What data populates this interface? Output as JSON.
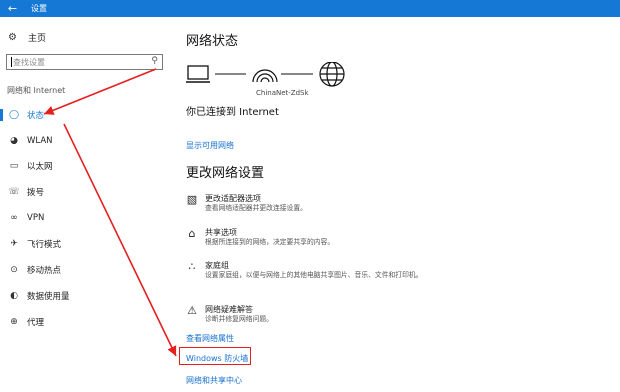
{
  "window": {
    "title": "设置",
    "back_icon": "back-arrow-icon"
  },
  "sidebar": {
    "home_label": "主页",
    "search_placeholder": "查找设置",
    "section_title": "网络和 Internet",
    "items": [
      {
        "label": "状态",
        "icon": "status-globe-icon",
        "active": true
      },
      {
        "label": "WLAN",
        "icon": "wifi-icon",
        "active": false
      },
      {
        "label": "以太网",
        "icon": "ethernet-icon",
        "active": false
      },
      {
        "label": "拨号",
        "icon": "dialup-phone-icon",
        "active": false
      },
      {
        "label": "VPN",
        "icon": "vpn-icon",
        "active": false
      },
      {
        "label": "飞行模式",
        "icon": "airplane-icon",
        "active": false
      },
      {
        "label": "移动热点",
        "icon": "hotspot-icon",
        "active": false
      },
      {
        "label": "数据使用量",
        "icon": "data-usage-icon",
        "active": false
      },
      {
        "label": "代理",
        "icon": "proxy-globe-icon",
        "active": false
      }
    ]
  },
  "main": {
    "status_heading": "网络状态",
    "network_name": "ChinaNet-ZdSk",
    "connected_text": "你已连接到 Internet",
    "show_networks_link": "显示可用网络",
    "change_heading": "更改网络设置",
    "options": [
      {
        "title": "更改适配器选项",
        "desc": "查看网络适配器并更改连接设置。",
        "icon": "adapter-icon"
      },
      {
        "title": "共享选项",
        "desc": "根据所连接到的网络，决定要共享的内容。",
        "icon": "sharing-icon"
      },
      {
        "title": "家庭组",
        "desc": "设置家庭组，以便与网络上的其他电脑共享图片、音乐、文件和打印机。",
        "icon": "homegroup-icon"
      },
      {
        "title": "网络疑难解答",
        "desc": "诊断并修复网络问题。",
        "icon": "warning-icon"
      }
    ],
    "links": {
      "properties": "查看网络属性",
      "firewall": "Windows 防火墙",
      "sharing_center": "网络和共享中心"
    }
  },
  "colors": {
    "accent": "#1578d4",
    "annotation": "#e52020",
    "link": "#1670d0"
  }
}
